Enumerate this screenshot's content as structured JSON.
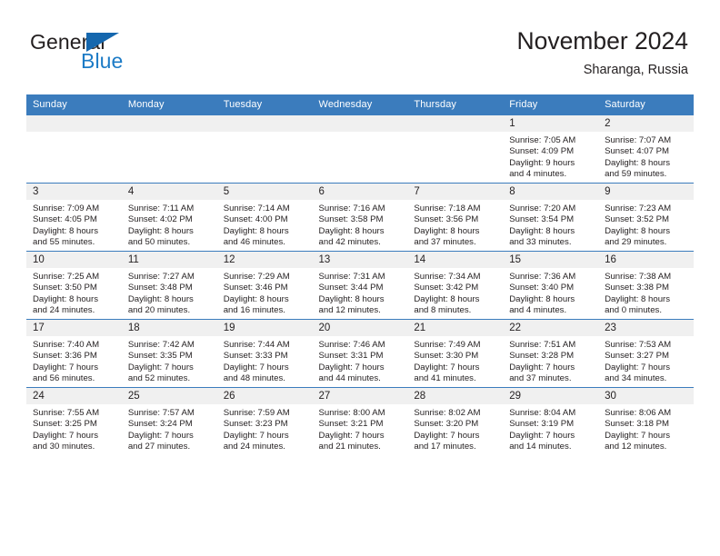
{
  "brand": {
    "word_one": "General",
    "word_two": "Blue",
    "flag_icon": "triangle-flag-icon",
    "color_blue": "#1c7bc6",
    "color_flag": "#1567ae"
  },
  "header": {
    "month_title": "November 2024",
    "location": "Sharanga, Russia"
  },
  "theme": {
    "header_row_bg": "#3b7cbd",
    "cell_head_bg": "#f0f0f0",
    "text": "#231f20"
  },
  "calendar": {
    "weekday_headers": [
      "Sunday",
      "Monday",
      "Tuesday",
      "Wednesday",
      "Thursday",
      "Friday",
      "Saturday"
    ],
    "weeks": [
      [
        {
          "day": "",
          "empty": true,
          "sunrise": "",
          "sunset": "",
          "daylight_line1": "",
          "daylight_line2": ""
        },
        {
          "day": "",
          "empty": true,
          "sunrise": "",
          "sunset": "",
          "daylight_line1": "",
          "daylight_line2": ""
        },
        {
          "day": "",
          "empty": true,
          "sunrise": "",
          "sunset": "",
          "daylight_line1": "",
          "daylight_line2": ""
        },
        {
          "day": "",
          "empty": true,
          "sunrise": "",
          "sunset": "",
          "daylight_line1": "",
          "daylight_line2": ""
        },
        {
          "day": "",
          "empty": true,
          "sunrise": "",
          "sunset": "",
          "daylight_line1": "",
          "daylight_line2": ""
        },
        {
          "day": "1",
          "empty": false,
          "sunrise": "Sunrise: 7:05 AM",
          "sunset": "Sunset: 4:09 PM",
          "daylight_line1": "Daylight: 9 hours",
          "daylight_line2": "and 4 minutes."
        },
        {
          "day": "2",
          "empty": false,
          "sunrise": "Sunrise: 7:07 AM",
          "sunset": "Sunset: 4:07 PM",
          "daylight_line1": "Daylight: 8 hours",
          "daylight_line2": "and 59 minutes."
        }
      ],
      [
        {
          "day": "3",
          "empty": false,
          "sunrise": "Sunrise: 7:09 AM",
          "sunset": "Sunset: 4:05 PM",
          "daylight_line1": "Daylight: 8 hours",
          "daylight_line2": "and 55 minutes."
        },
        {
          "day": "4",
          "empty": false,
          "sunrise": "Sunrise: 7:11 AM",
          "sunset": "Sunset: 4:02 PM",
          "daylight_line1": "Daylight: 8 hours",
          "daylight_line2": "and 50 minutes."
        },
        {
          "day": "5",
          "empty": false,
          "sunrise": "Sunrise: 7:14 AM",
          "sunset": "Sunset: 4:00 PM",
          "daylight_line1": "Daylight: 8 hours",
          "daylight_line2": "and 46 minutes."
        },
        {
          "day": "6",
          "empty": false,
          "sunrise": "Sunrise: 7:16 AM",
          "sunset": "Sunset: 3:58 PM",
          "daylight_line1": "Daylight: 8 hours",
          "daylight_line2": "and 42 minutes."
        },
        {
          "day": "7",
          "empty": false,
          "sunrise": "Sunrise: 7:18 AM",
          "sunset": "Sunset: 3:56 PM",
          "daylight_line1": "Daylight: 8 hours",
          "daylight_line2": "and 37 minutes."
        },
        {
          "day": "8",
          "empty": false,
          "sunrise": "Sunrise: 7:20 AM",
          "sunset": "Sunset: 3:54 PM",
          "daylight_line1": "Daylight: 8 hours",
          "daylight_line2": "and 33 minutes."
        },
        {
          "day": "9",
          "empty": false,
          "sunrise": "Sunrise: 7:23 AM",
          "sunset": "Sunset: 3:52 PM",
          "daylight_line1": "Daylight: 8 hours",
          "daylight_line2": "and 29 minutes."
        }
      ],
      [
        {
          "day": "10",
          "empty": false,
          "sunrise": "Sunrise: 7:25 AM",
          "sunset": "Sunset: 3:50 PM",
          "daylight_line1": "Daylight: 8 hours",
          "daylight_line2": "and 24 minutes."
        },
        {
          "day": "11",
          "empty": false,
          "sunrise": "Sunrise: 7:27 AM",
          "sunset": "Sunset: 3:48 PM",
          "daylight_line1": "Daylight: 8 hours",
          "daylight_line2": "and 20 minutes."
        },
        {
          "day": "12",
          "empty": false,
          "sunrise": "Sunrise: 7:29 AM",
          "sunset": "Sunset: 3:46 PM",
          "daylight_line1": "Daylight: 8 hours",
          "daylight_line2": "and 16 minutes."
        },
        {
          "day": "13",
          "empty": false,
          "sunrise": "Sunrise: 7:31 AM",
          "sunset": "Sunset: 3:44 PM",
          "daylight_line1": "Daylight: 8 hours",
          "daylight_line2": "and 12 minutes."
        },
        {
          "day": "14",
          "empty": false,
          "sunrise": "Sunrise: 7:34 AM",
          "sunset": "Sunset: 3:42 PM",
          "daylight_line1": "Daylight: 8 hours",
          "daylight_line2": "and 8 minutes."
        },
        {
          "day": "15",
          "empty": false,
          "sunrise": "Sunrise: 7:36 AM",
          "sunset": "Sunset: 3:40 PM",
          "daylight_line1": "Daylight: 8 hours",
          "daylight_line2": "and 4 minutes."
        },
        {
          "day": "16",
          "empty": false,
          "sunrise": "Sunrise: 7:38 AM",
          "sunset": "Sunset: 3:38 PM",
          "daylight_line1": "Daylight: 8 hours",
          "daylight_line2": "and 0 minutes."
        }
      ],
      [
        {
          "day": "17",
          "empty": false,
          "sunrise": "Sunrise: 7:40 AM",
          "sunset": "Sunset: 3:36 PM",
          "daylight_line1": "Daylight: 7 hours",
          "daylight_line2": "and 56 minutes."
        },
        {
          "day": "18",
          "empty": false,
          "sunrise": "Sunrise: 7:42 AM",
          "sunset": "Sunset: 3:35 PM",
          "daylight_line1": "Daylight: 7 hours",
          "daylight_line2": "and 52 minutes."
        },
        {
          "day": "19",
          "empty": false,
          "sunrise": "Sunrise: 7:44 AM",
          "sunset": "Sunset: 3:33 PM",
          "daylight_line1": "Daylight: 7 hours",
          "daylight_line2": "and 48 minutes."
        },
        {
          "day": "20",
          "empty": false,
          "sunrise": "Sunrise: 7:46 AM",
          "sunset": "Sunset: 3:31 PM",
          "daylight_line1": "Daylight: 7 hours",
          "daylight_line2": "and 44 minutes."
        },
        {
          "day": "21",
          "empty": false,
          "sunrise": "Sunrise: 7:49 AM",
          "sunset": "Sunset: 3:30 PM",
          "daylight_line1": "Daylight: 7 hours",
          "daylight_line2": "and 41 minutes."
        },
        {
          "day": "22",
          "empty": false,
          "sunrise": "Sunrise: 7:51 AM",
          "sunset": "Sunset: 3:28 PM",
          "daylight_line1": "Daylight: 7 hours",
          "daylight_line2": "and 37 minutes."
        },
        {
          "day": "23",
          "empty": false,
          "sunrise": "Sunrise: 7:53 AM",
          "sunset": "Sunset: 3:27 PM",
          "daylight_line1": "Daylight: 7 hours",
          "daylight_line2": "and 34 minutes."
        }
      ],
      [
        {
          "day": "24",
          "empty": false,
          "sunrise": "Sunrise: 7:55 AM",
          "sunset": "Sunset: 3:25 PM",
          "daylight_line1": "Daylight: 7 hours",
          "daylight_line2": "and 30 minutes."
        },
        {
          "day": "25",
          "empty": false,
          "sunrise": "Sunrise: 7:57 AM",
          "sunset": "Sunset: 3:24 PM",
          "daylight_line1": "Daylight: 7 hours",
          "daylight_line2": "and 27 minutes."
        },
        {
          "day": "26",
          "empty": false,
          "sunrise": "Sunrise: 7:59 AM",
          "sunset": "Sunset: 3:23 PM",
          "daylight_line1": "Daylight: 7 hours",
          "daylight_line2": "and 24 minutes."
        },
        {
          "day": "27",
          "empty": false,
          "sunrise": "Sunrise: 8:00 AM",
          "sunset": "Sunset: 3:21 PM",
          "daylight_line1": "Daylight: 7 hours",
          "daylight_line2": "and 21 minutes."
        },
        {
          "day": "28",
          "empty": false,
          "sunrise": "Sunrise: 8:02 AM",
          "sunset": "Sunset: 3:20 PM",
          "daylight_line1": "Daylight: 7 hours",
          "daylight_line2": "and 17 minutes."
        },
        {
          "day": "29",
          "empty": false,
          "sunrise": "Sunrise: 8:04 AM",
          "sunset": "Sunset: 3:19 PM",
          "daylight_line1": "Daylight: 7 hours",
          "daylight_line2": "and 14 minutes."
        },
        {
          "day": "30",
          "empty": false,
          "sunrise": "Sunrise: 8:06 AM",
          "sunset": "Sunset: 3:18 PM",
          "daylight_line1": "Daylight: 7 hours",
          "daylight_line2": "and 12 minutes."
        }
      ]
    ]
  }
}
